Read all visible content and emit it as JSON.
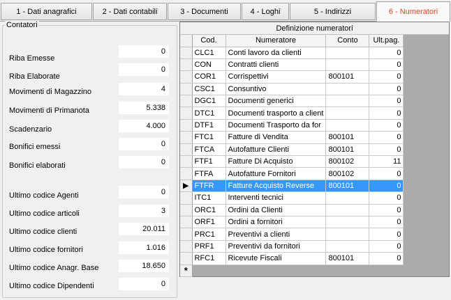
{
  "tabs": [
    {
      "label": "1 - Dati anagrafici"
    },
    {
      "label": "2 - Dati contabili"
    },
    {
      "label": "3 - Documenti"
    },
    {
      "label": "4 - Loghi"
    },
    {
      "label": "5 - Indirizzi"
    },
    {
      "label": "6 - Numeratori"
    }
  ],
  "active_tab_color": "#e8431f",
  "contatori": {
    "title": "Contatori",
    "items": [
      {
        "label": "Riba Emesse",
        "value": "0"
      },
      {
        "label": "Riba Elaborate",
        "value": "0"
      },
      {
        "label": "Movimenti di Magazzino",
        "value": "4"
      },
      {
        "label": "Movimenti di Primanota",
        "value": "5.338"
      },
      {
        "label": "Scadenzario",
        "value": "4.000"
      },
      {
        "label": "Bonifici emessi",
        "value": "0"
      },
      {
        "label": "Bonifici elaborati",
        "value": "0"
      },
      {
        "label": "Ultimo codice Agenti",
        "value": "0"
      },
      {
        "label": "Ultimo codice articoli",
        "value": "3"
      },
      {
        "label": "Ultimo codice clienti",
        "value": "20.011"
      },
      {
        "label": "Ultimo codice fornitori",
        "value": "1.016"
      },
      {
        "label": "Ultimo codice Anagr. Base",
        "value": "18.650"
      },
      {
        "label": "Ultimo codice Dipendenti",
        "value": "0"
      }
    ]
  },
  "grid": {
    "caption": "Definizione numeratori",
    "columns": [
      "Cod.",
      "Numeratore",
      "Conto",
      "Ult.pag."
    ],
    "selected_indicator": "▶",
    "new_row_indicator": "*",
    "selection_color": "#3399ff",
    "rows": [
      {
        "cod": "CLC1",
        "numeratore": "Conti lavoro da clienti",
        "conto": "",
        "ult": "0"
      },
      {
        "cod": "CON",
        "numeratore": "Contratti clienti",
        "conto": "",
        "ult": "0"
      },
      {
        "cod": "COR1",
        "numeratore": "Corrispettivi",
        "conto": "800101",
        "ult": "0"
      },
      {
        "cod": "CSC1",
        "numeratore": "Consuntivo",
        "conto": "",
        "ult": "0"
      },
      {
        "cod": "DGC1",
        "numeratore": "Documenti generici",
        "conto": "",
        "ult": "0"
      },
      {
        "cod": "DTC1",
        "numeratore": "Documenti trasporto a client",
        "conto": "",
        "ult": "0"
      },
      {
        "cod": "DTF1",
        "numeratore": "Documenti Trasporto da for",
        "conto": "",
        "ult": "0"
      },
      {
        "cod": "FTC1",
        "numeratore": "Fatture di Vendita",
        "conto": "800101",
        "ult": "0"
      },
      {
        "cod": "FTCA",
        "numeratore": "Autofatture Clienti",
        "conto": "800101",
        "ult": "0"
      },
      {
        "cod": "FTF1",
        "numeratore": "Fatture Di Acquisto",
        "conto": "800102",
        "ult": "11"
      },
      {
        "cod": "FTFA",
        "numeratore": "Autofatture Fornitori",
        "conto": "800102",
        "ult": "0"
      },
      {
        "cod": "FTFR",
        "numeratore": "Fatture Acquisto Reverse",
        "conto": "800101",
        "ult": "0",
        "selected": true
      },
      {
        "cod": "ITC1",
        "numeratore": "Interventi tecnici",
        "conto": "",
        "ult": "0"
      },
      {
        "cod": "ORC1",
        "numeratore": "Ordini da Clienti",
        "conto": "",
        "ult": "0"
      },
      {
        "cod": "ORF1",
        "numeratore": "Ordini a fornitori",
        "conto": "",
        "ult": "0"
      },
      {
        "cod": "PRC1",
        "numeratore": "Preventivi a clienti",
        "conto": "",
        "ult": "0"
      },
      {
        "cod": "PRF1",
        "numeratore": "Preventivi da fornitori",
        "conto": "",
        "ult": "0"
      },
      {
        "cod": "RFC1",
        "numeratore": "Ricevute Fiscali",
        "conto": "800101",
        "ult": "0"
      }
    ]
  }
}
